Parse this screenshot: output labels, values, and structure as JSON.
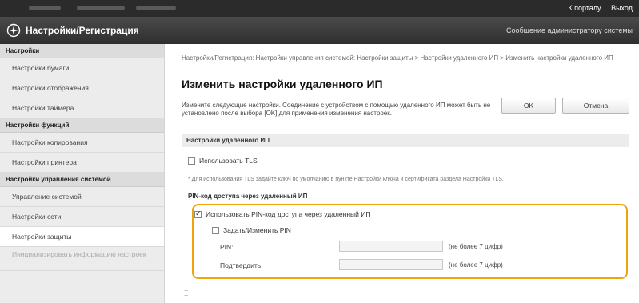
{
  "topbar": {
    "portal_link": "К порталу",
    "logout_link": "Выход"
  },
  "header": {
    "title": "Настройки/Регистрация",
    "admin_message": "Сообщение администратору системы"
  },
  "sidebar": {
    "groups": [
      {
        "label": "Настройки",
        "items": [
          "Настройки бумаги",
          "Настройки отображения",
          "Настройки таймера"
        ]
      },
      {
        "label": "Настройки функций",
        "items": [
          "Настройки копирования",
          "Настройки принтера"
        ]
      },
      {
        "label": "Настройки управления системой",
        "items": [
          "Управление системой",
          "Настройки сети",
          "Настройки защиты",
          "Инициализировать информацию настроек"
        ]
      }
    ]
  },
  "main": {
    "breadcrumb": "Настройки/Регистрация: Настройки управления системой: Настройки защиты > Настройки удаленного ИП > Изменить настройки удаленного ИП",
    "page_title": "Изменить настройки удаленного ИП",
    "description": "Измените следующие настройки. Соединение с устройством с помощью удаленного ИП может быть не установлено после выбора [OK] для применения изменения настроек.",
    "ok_label": "OK",
    "cancel_label": "Отмена",
    "section_title": "Настройки удаленного ИП",
    "use_tls_label": "Использовать TLS",
    "use_tls_checked": false,
    "tls_note": "* Для использования TLS задайте ключ по умолчанию в пункте Настройки ключа и сертификата раздела Настройки TLS.",
    "pin_subhead": "PIN-код доступа через удаленный ИП",
    "use_pin_label": "Использовать PIN-код доступа через удаленный ИП",
    "use_pin_checked": true,
    "set_pin_label": "Задать/Изменить PIN",
    "set_pin_checked": false,
    "pin_label": "PIN:",
    "pin_value": "",
    "pin_hint": "(не более 7 цифр)",
    "confirm_label": "Подтвердить:",
    "confirm_value": "",
    "confirm_hint": "(не более 7 цифр)"
  },
  "colors": {
    "highlight": "#f0a30a",
    "header": "#3a3a3a"
  }
}
